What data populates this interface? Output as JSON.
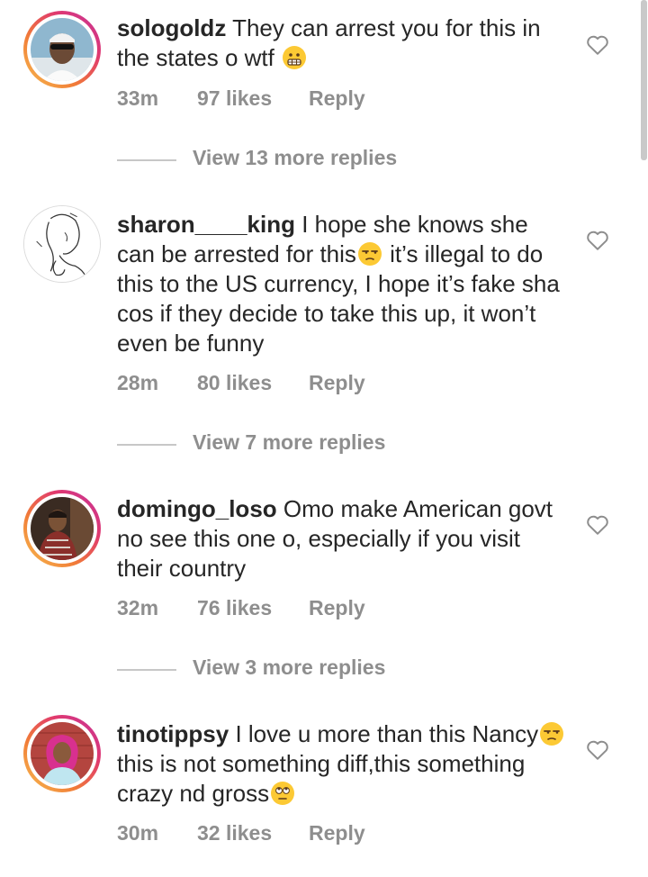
{
  "comments": [
    {
      "username": "sologoldz",
      "text_parts": [
        "They can arrest you for this in the states o wtf "
      ],
      "emoji": [
        "grimacing-emoji"
      ],
      "time": "33m",
      "likes": "97 likes",
      "reply_label": "Reply",
      "view_replies": "View 13 more replies",
      "story_ring": true
    },
    {
      "username": "sharon____king",
      "text_parts": [
        "I hope she knows she can be arrested for this",
        " it’s illegal to do this to the US currency, I hope it’s fake sha cos if they decide to take this up, it won’t even be funny"
      ],
      "emoji": [
        "unamused-emoji"
      ],
      "time": "28m",
      "likes": "80 likes",
      "reply_label": "Reply",
      "view_replies": "View 7 more replies",
      "story_ring": false
    },
    {
      "username": "domingo_loso",
      "text_parts": [
        "Omo make American govt no see this one o, especially if you visit their country"
      ],
      "emoji": [],
      "time": "32m",
      "likes": "76 likes",
      "reply_label": "Reply",
      "view_replies": "View 3 more replies",
      "story_ring": true
    },
    {
      "username": "tinotippsy",
      "text_parts": [
        "I love u more than this Nancy",
        "this is not something diff,this something crazy nd gross",
        ""
      ],
      "emoji": [
        "unamused-emoji",
        "eye-roll-emoji"
      ],
      "time": "30m",
      "likes": "32 likes",
      "reply_label": "Reply",
      "story_ring": true
    }
  ],
  "colors": {
    "text": "#262626",
    "muted": "#8e8e8e",
    "emoji": "#fcc934",
    "story_ring": [
      "#f7c052",
      "#e0386f",
      "#c235a0"
    ]
  }
}
